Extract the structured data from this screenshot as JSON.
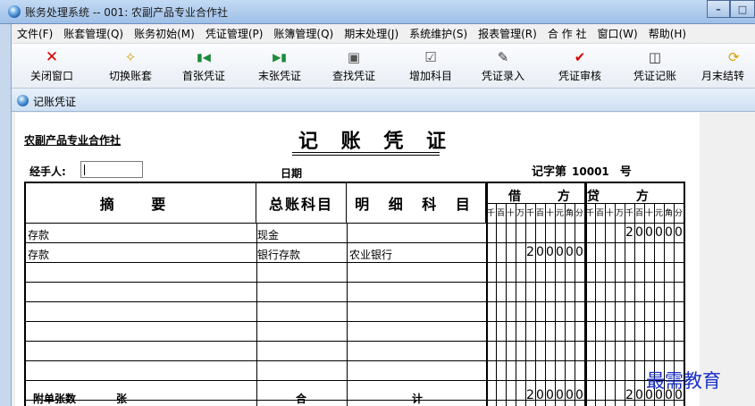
{
  "window": {
    "title": "账务处理系统 -- 001: 农副产品专业合作社"
  },
  "menu": [
    "文件(F)",
    "账套管理(Q)",
    "账务初始(M)",
    "凭证管理(P)",
    "账簿管理(Q)",
    "期末处理(J)",
    "系统维护(S)",
    "报表管理(R)",
    "合 作 社",
    "窗口(W)",
    "帮助(H)"
  ],
  "toolbar": [
    {
      "label": "关闭窗口",
      "icon": "close-icon"
    },
    {
      "label": "切换账套",
      "icon": "switch-icon"
    },
    {
      "label": "首张凭证",
      "icon": "first-icon"
    },
    {
      "label": "末张凭证",
      "icon": "last-icon"
    },
    {
      "label": "查找凭证",
      "icon": "find-icon"
    },
    {
      "label": "增加科目",
      "icon": "add-account-icon"
    },
    {
      "label": "凭证录入",
      "icon": "entry-icon"
    },
    {
      "label": "凭证审核",
      "icon": "audit-icon"
    },
    {
      "label": "凭证记账",
      "icon": "posting-icon"
    },
    {
      "label": "月末结转",
      "icon": "month-end-icon"
    }
  ],
  "subwindow": {
    "title": "记账凭证"
  },
  "voucher": {
    "company": "农副产品专业合作社",
    "title": "记 账 凭 证",
    "handler_label": "经手人:",
    "handler_value": "",
    "date_label": "日期",
    "voucher_label_prefix": "记字第",
    "voucher_no": "10001",
    "voucher_label_suffix": "号",
    "headers": {
      "summary": "摘  要",
      "general": "总账科目",
      "detail": "明 细 科 目",
      "debit": "借  方",
      "credit": "贷  方"
    },
    "amount_units": [
      "千",
      "百",
      "十",
      "万",
      "千",
      "百",
      "十",
      "元",
      "角",
      "分"
    ],
    "rows": [
      {
        "summary": "存款",
        "general": "现金",
        "detail": "",
        "debit": "",
        "credit": "200000"
      },
      {
        "summary": "存款",
        "general": "银行存款",
        "detail": "农业银行",
        "debit": "200000",
        "credit": ""
      }
    ],
    "footer": {
      "attach": "附单张数",
      "unit": "张",
      "total1": "合",
      "total2": "计",
      "total_debit": "200000",
      "total_credit": "200000"
    }
  },
  "watermark": "最需教育"
}
